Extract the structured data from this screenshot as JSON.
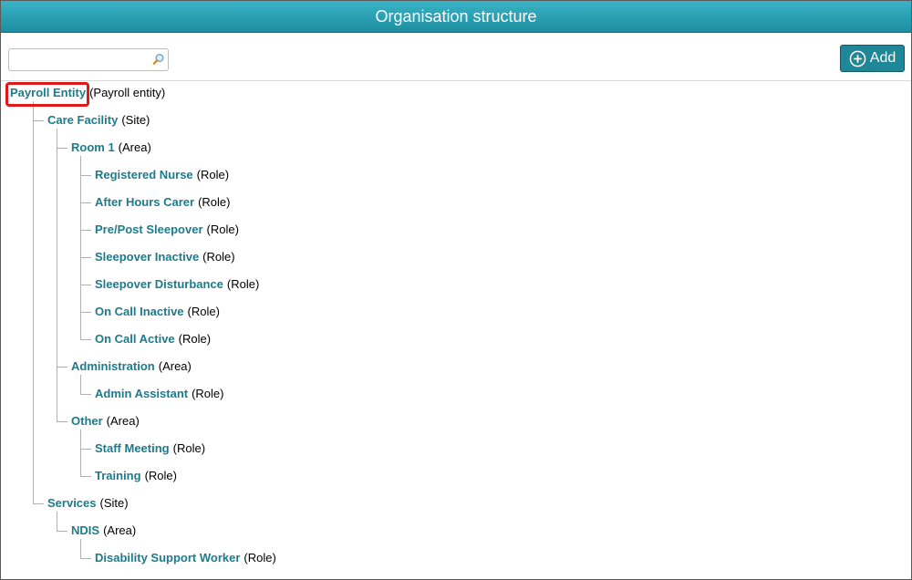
{
  "window": {
    "title": "Organisation structure"
  },
  "toolbar": {
    "search_value": "",
    "add_label": "Add"
  },
  "tree": {
    "nodes": [
      {
        "name": "Payroll Entity",
        "type": "(Payroll entity)"
      },
      {
        "name": "Care Facility",
        "type": "(Site)"
      },
      {
        "name": "Room 1",
        "type": "(Area)"
      },
      {
        "name": "Registered Nurse",
        "type": "(Role)"
      },
      {
        "name": "After Hours Carer",
        "type": "(Role)"
      },
      {
        "name": "Pre/Post Sleepover",
        "type": "(Role)"
      },
      {
        "name": "Sleepover Inactive",
        "type": "(Role)"
      },
      {
        "name": "Sleepover Disturbance",
        "type": "(Role)"
      },
      {
        "name": "On Call Inactive",
        "type": "(Role)"
      },
      {
        "name": "On Call Active",
        "type": "(Role)"
      },
      {
        "name": "Administration",
        "type": "(Area)"
      },
      {
        "name": "Admin Assistant",
        "type": "(Role)"
      },
      {
        "name": "Other",
        "type": "(Area)"
      },
      {
        "name": "Staff Meeting",
        "type": "(Role)"
      },
      {
        "name": "Training",
        "type": "(Role)"
      },
      {
        "name": "Services",
        "type": "(Site)"
      },
      {
        "name": "NDIS",
        "type": "(Area)"
      },
      {
        "name": "Disability Support Worker",
        "type": "(Role)"
      }
    ]
  },
  "colors": {
    "title_bar": "#2aa3b5",
    "link": "#1c7b8c",
    "highlight": "#e01818"
  }
}
